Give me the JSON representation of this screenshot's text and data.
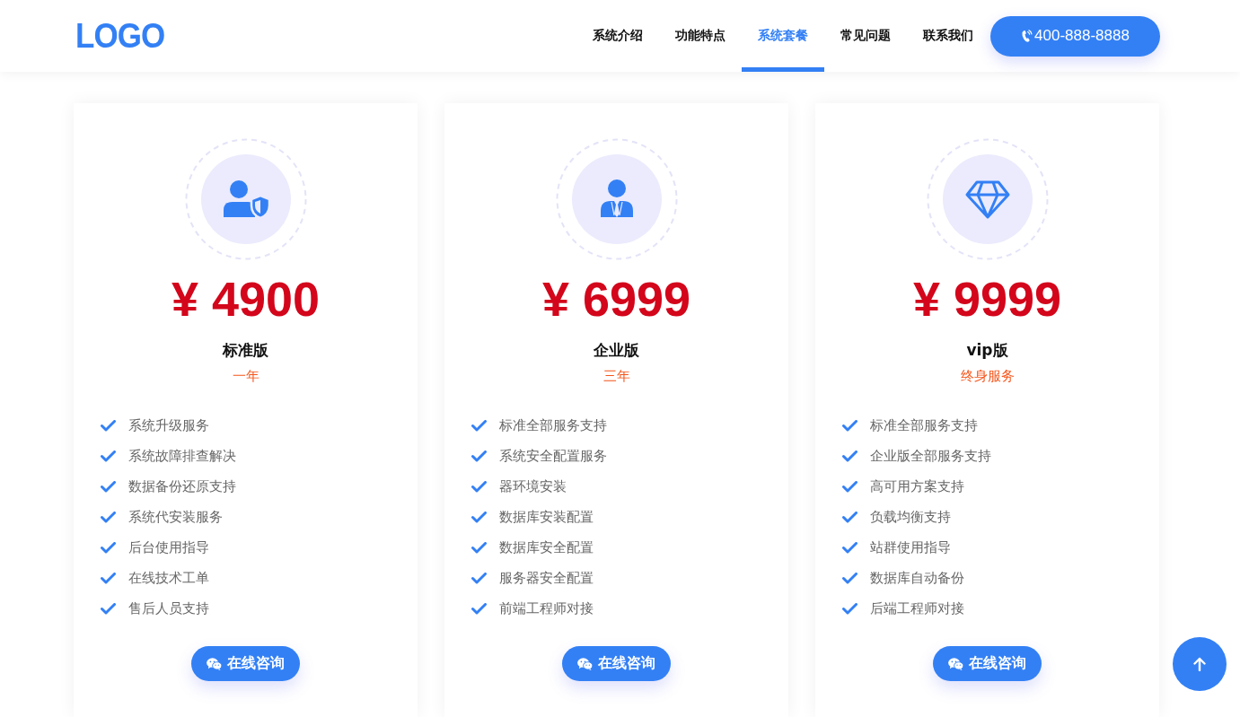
{
  "header": {
    "logo": "LOGO",
    "nav": [
      {
        "label": "系统介绍",
        "selected": false
      },
      {
        "label": "功能特点",
        "selected": false
      },
      {
        "label": "系统套餐",
        "selected": true
      },
      {
        "label": "常见问题",
        "selected": false
      },
      {
        "label": "联系我们",
        "selected": false
      }
    ],
    "phone_button": "400-888-8888"
  },
  "plans": [
    {
      "kind": "shield",
      "price": "¥ 4900",
      "name": "标准版",
      "period": "一年",
      "features": [
        "系统升级服务",
        "系统故障排查解决",
        "数据备份还原支持",
        "系统代安装服务",
        "后台使用指导",
        "在线技术工单",
        "售后人员支持"
      ],
      "button": "在线咨询"
    },
    {
      "kind": "suit",
      "price": "¥ 6999",
      "name": "企业版",
      "period": "三年",
      "features": [
        "标准全部服务支持",
        "系统安全配置服务",
        "器环境安装",
        "数据库安装配置",
        "数据库安全配置",
        "服务器安全配置",
        "前端工程师对接"
      ],
      "button": "在线咨询"
    },
    {
      "kind": "gem",
      "price": "¥ 9999",
      "name": "vip版",
      "period": "终身服务",
      "features": [
        "标准全部服务支持",
        "企业版全部服务支持",
        "高可用方案支持",
        "负载均衡支持",
        "站群使用指导",
        "数据库自动备份",
        "后端工程师对接"
      ],
      "button": "在线咨询"
    }
  ]
}
